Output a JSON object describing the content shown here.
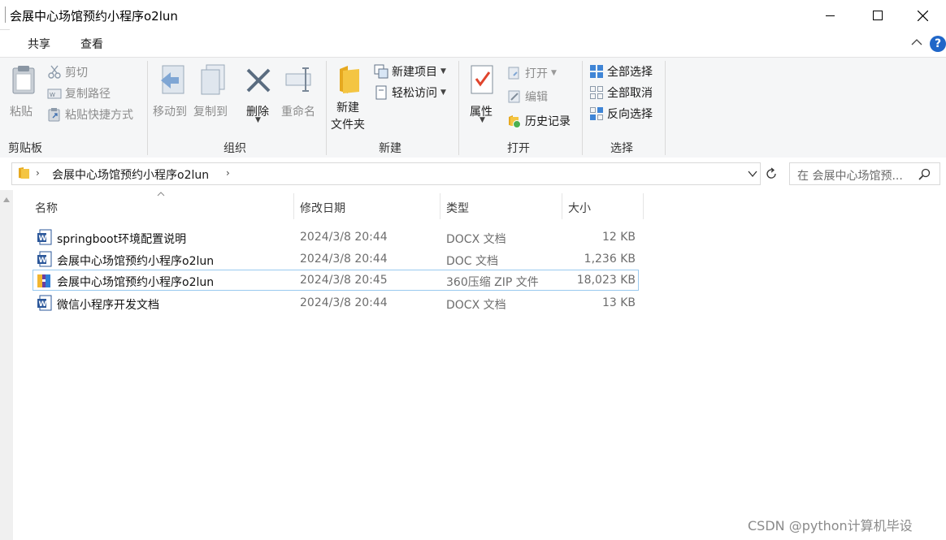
{
  "window": {
    "title": "会展中心场馆预约小程序o2lun"
  },
  "tabs": [
    {
      "label": "共享"
    },
    {
      "label": "查看"
    }
  ],
  "ribbon": {
    "clipboard": {
      "group_label": "剪贴板",
      "paste": "粘贴",
      "cut": "剪切",
      "copy_path": "复制路径",
      "paste_shortcut": "粘贴快捷方式"
    },
    "organize": {
      "group_label": "组织",
      "move_to": "移动到",
      "copy_to": "复制到",
      "delete": "删除",
      "rename": "重命名"
    },
    "new": {
      "group_label": "新建",
      "new_folder_line1": "新建",
      "new_folder_line2": "文件夹",
      "new_item": "新建项目",
      "easy_access": "轻松访问"
    },
    "open": {
      "group_label": "打开",
      "properties": "属性",
      "open": "打开",
      "edit": "编辑",
      "history": "历史记录"
    },
    "select": {
      "group_label": "选择",
      "select_all": "全部选择",
      "select_none": "全部取消",
      "invert": "反向选择"
    }
  },
  "address": {
    "path": "会展中心场馆预约小程序o2lun",
    "search_placeholder": "在 会展中心场馆预..."
  },
  "columns": {
    "name": "名称",
    "modified": "修改日期",
    "type": "类型",
    "size": "大小"
  },
  "files": [
    {
      "name": "springboot环境配置说明",
      "modified": "2024/3/8 20:44",
      "type": "DOCX 文档",
      "size": "12 KB",
      "icon": "word-doc-icon"
    },
    {
      "name": "会展中心场馆预约小程序o2lun",
      "modified": "2024/3/8 20:44",
      "type": "DOC 文档",
      "size": "1,236 KB",
      "icon": "word-doc-icon"
    },
    {
      "name": "会展中心场馆预约小程序o2lun",
      "modified": "2024/3/8 20:45",
      "type": "360压缩 ZIP 文件",
      "size": "18,023 KB",
      "icon": "zip-archive-icon"
    },
    {
      "name": "微信小程序开发文档",
      "modified": "2024/3/8 20:44",
      "type": "DOCX 文档",
      "size": "13 KB",
      "icon": "word-doc-icon"
    }
  ],
  "watermark": "CSDN @python计算机毕设",
  "colors": {
    "accent": "#1f66c8",
    "selection_border": "#99c9ef",
    "folder": "#f4c542"
  }
}
